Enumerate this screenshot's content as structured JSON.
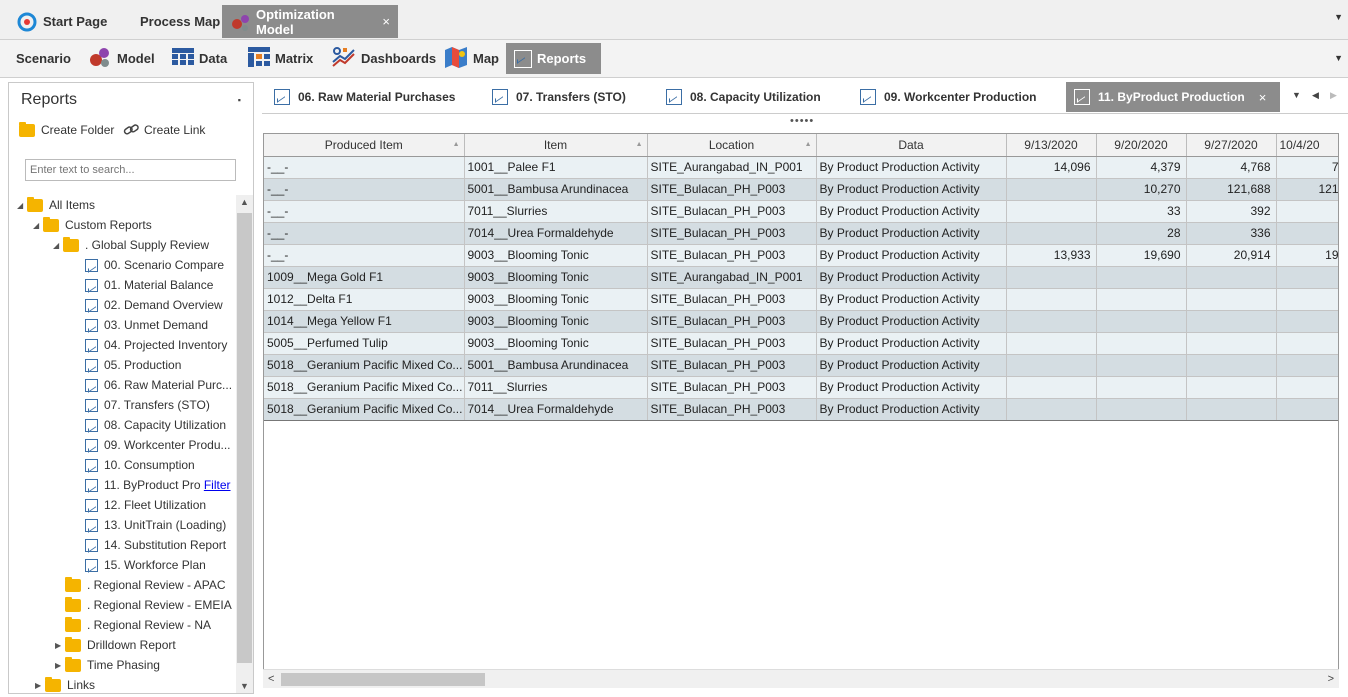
{
  "top_tabs": [
    {
      "label": "Start Page"
    },
    {
      "label": "Process Map"
    },
    {
      "label": "Optimization Model",
      "close": "×"
    }
  ],
  "ribbon": {
    "tabs": [
      "Scenario",
      "Model",
      "Data",
      "Matrix",
      "Dashboards",
      "Map",
      "Reports"
    ]
  },
  "sidebar": {
    "title": "Reports",
    "create_folder": "Create Folder",
    "create_link": "Create Link",
    "search_placeholder": "Enter text to search...",
    "tree": [
      "All Items",
      "Custom Reports",
      ". Global Supply Review",
      "00. Scenario Compare",
      "01. Material Balance",
      "02. Demand Overview",
      "03. Unmet Demand",
      "04. Projected Inventory",
      "05. Production",
      "06. Raw Material Purc...",
      "07. Transfers (STO)",
      "08. Capacity Utilization",
      "09. Workcenter Produ...",
      "10. Consumption",
      "11. ByProduct Pro",
      "12. Fleet Utilization",
      "13. UnitTrain (Loading)",
      "14. Substitution Report",
      "15. Workforce Plan",
      ". Regional Review - APAC",
      ". Regional Review - EMEIA",
      ". Regional Review - NA",
      "Drilldown Report",
      "Time Phasing",
      "Links"
    ],
    "filter_link": "Filter"
  },
  "report_tabs": [
    "06. Raw Material Purchases",
    "07. Transfers (STO)",
    "08. Capacity Utilization",
    "09. Workcenter Production",
    "11. ByProduct Production"
  ],
  "report_tab_close": "×",
  "grid": {
    "headers": [
      "Produced Item",
      "Item",
      "Location",
      "Data",
      "9/13/2020",
      "9/20/2020",
      "9/27/2020",
      "10/4/20"
    ],
    "rows": [
      [
        "-__-",
        "1001__Palee F1",
        "SITE_Aurangabad_IN_P001",
        "By Product Production Activity",
        "14,096",
        "4,379",
        "4,768",
        "7"
      ],
      [
        "-__-",
        "5001__Bambusa Arundinacea",
        "SITE_Bulacan_PH_P003",
        "By Product Production Activity",
        "",
        "10,270",
        "121,688",
        "121"
      ],
      [
        "-__-",
        "7011__Slurries",
        "SITE_Bulacan_PH_P003",
        "By Product Production Activity",
        "",
        "33",
        "392",
        ""
      ],
      [
        "-__-",
        "7014__Urea Formaldehyde",
        "SITE_Bulacan_PH_P003",
        "By Product Production Activity",
        "",
        "28",
        "336",
        ""
      ],
      [
        "-__-",
        "9003__Blooming Tonic",
        "SITE_Bulacan_PH_P003",
        "By Product Production Activity",
        "13,933",
        "19,690",
        "20,914",
        "19"
      ],
      [
        "1009__Mega Gold F1",
        "9003__Blooming Tonic",
        "SITE_Aurangabad_IN_P001",
        "By Product Production Activity",
        "",
        "",
        "",
        ""
      ],
      [
        "1012__Delta F1",
        "9003__Blooming Tonic",
        "SITE_Bulacan_PH_P003",
        "By Product Production Activity",
        "",
        "",
        "",
        ""
      ],
      [
        "1014__Mega Yellow F1",
        "9003__Blooming Tonic",
        "SITE_Bulacan_PH_P003",
        "By Product Production Activity",
        "",
        "",
        "",
        ""
      ],
      [
        "5005__Perfumed Tulip",
        "9003__Blooming Tonic",
        "SITE_Bulacan_PH_P003",
        "By Product Production Activity",
        "",
        "",
        "",
        ""
      ],
      [
        "5018__Geranium Pacific Mixed Co...",
        "5001__Bambusa Arundinacea",
        "SITE_Bulacan_PH_P003",
        "By Product Production Activity",
        "",
        "",
        "",
        ""
      ],
      [
        "5018__Geranium Pacific Mixed Co...",
        "7011__Slurries",
        "SITE_Bulacan_PH_P003",
        "By Product Production Activity",
        "",
        "",
        "",
        ""
      ],
      [
        "5018__Geranium Pacific Mixed Co...",
        "7014__Urea Formaldehyde",
        "SITE_Bulacan_PH_P003",
        "By Product Production Activity",
        "",
        "",
        "",
        ""
      ]
    ]
  }
}
